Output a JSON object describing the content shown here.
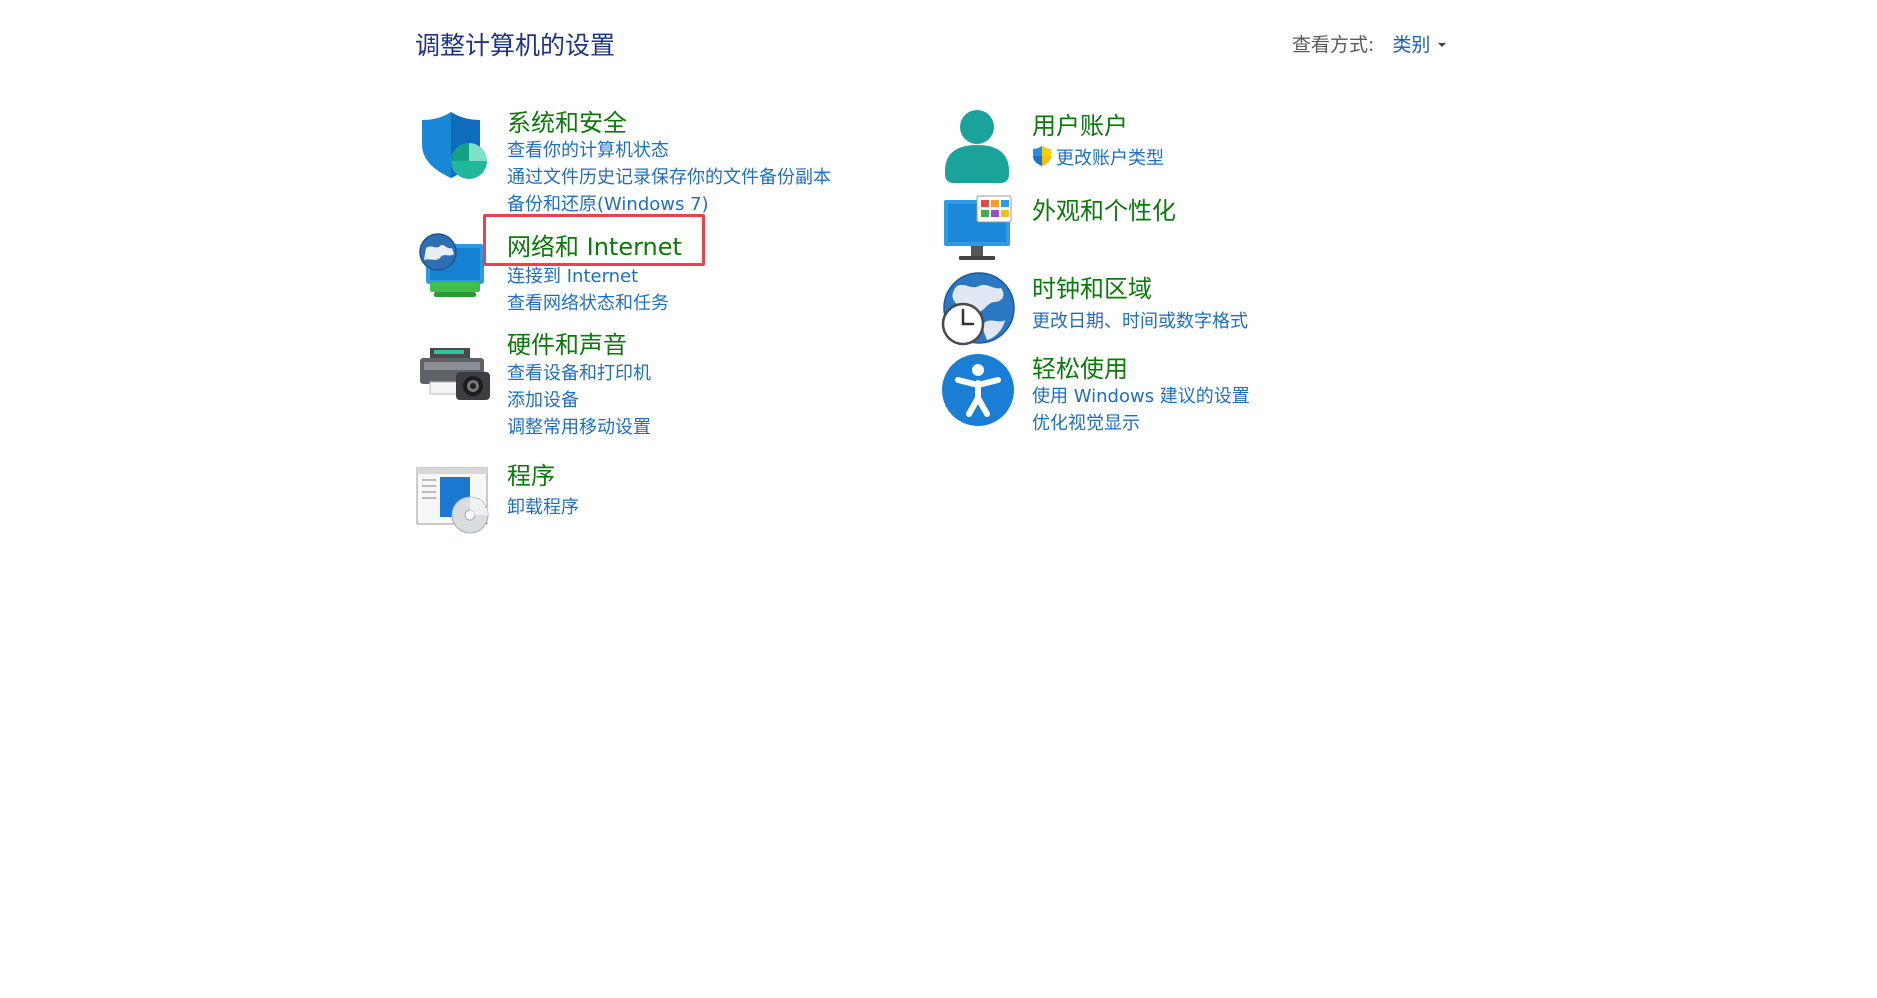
{
  "header": {
    "title": "调整计算机的设置",
    "view_by_label": "查看方式:",
    "view_by_value": "类别"
  },
  "categories": {
    "system_security": {
      "icon": "shield-security-icon",
      "title": "系统和安全",
      "links": [
        "查看你的计算机状态",
        "通过文件历史记录保存你的文件备份副本",
        "备份和还原(Windows 7)"
      ]
    },
    "network": {
      "icon": "network-globe-monitor-icon",
      "title": "网络和 Internet",
      "links": [
        "连接到 Internet",
        "查看网络状态和任务"
      ]
    },
    "hardware": {
      "icon": "printer-camera-icon",
      "title": "硬件和声音",
      "links": [
        "查看设备和打印机",
        "添加设备",
        "调整常用移动设置"
      ]
    },
    "programs": {
      "icon": "programs-disc-icon",
      "title": "程序",
      "links": [
        "卸载程序"
      ]
    },
    "user_accounts": {
      "icon": "user-account-icon",
      "title": "用户账户",
      "links": [
        "更改账户类型"
      ]
    },
    "appearance": {
      "icon": "appearance-monitor-icon",
      "title": "外观和个性化",
      "links": []
    },
    "clock_region": {
      "icon": "globe-clock-icon",
      "title": "时钟和区域",
      "links": [
        "更改日期、时间或数字格式"
      ]
    },
    "ease_access": {
      "icon": "accessibility-icon",
      "title": "轻松使用",
      "links": [
        "使用 Windows 建议的设置",
        "优化视觉显示"
      ]
    }
  },
  "colors": {
    "title_blue": "#1e3287",
    "category_green": "#0a7a0a",
    "link_blue": "#1f6fc0",
    "highlight_red": "#e8424c"
  }
}
